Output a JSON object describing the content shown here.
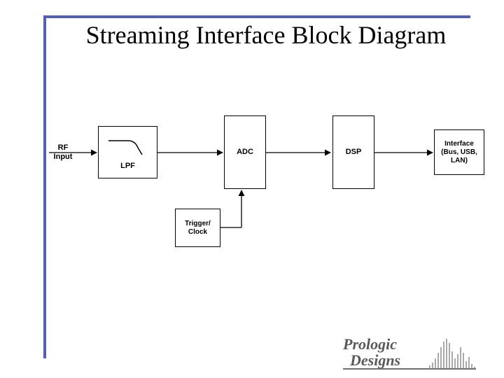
{
  "title": "Streaming Interface  Block Diagram",
  "blocks": {
    "rf_input": "RF\nInput",
    "lpf": "LPF",
    "adc": "ADC",
    "dsp": "DSP",
    "interface": "Interface\n(Bus, USB,\nLAN)",
    "trigger": "Trigger/\nClock"
  },
  "logo": {
    "line1": "Prologic",
    "line2": "Designs"
  }
}
